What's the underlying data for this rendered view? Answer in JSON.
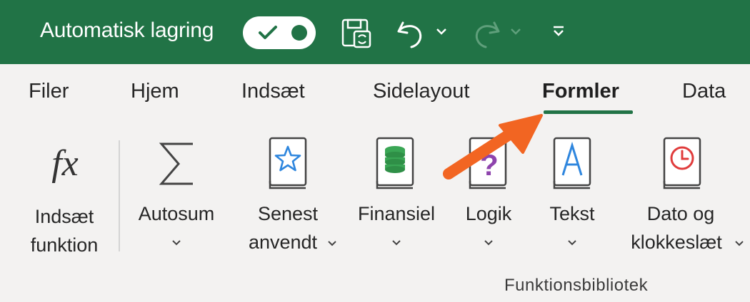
{
  "titlebar": {
    "autosave_label": "Automatisk lagring",
    "autosave_on": true
  },
  "tabs": [
    {
      "label": "Filer",
      "active": false
    },
    {
      "label": "Hjem",
      "active": false
    },
    {
      "label": "Indsæt",
      "active": false
    },
    {
      "label": "Sidelayout",
      "active": false
    },
    {
      "label": "Formler",
      "active": true
    },
    {
      "label": "Data",
      "active": false
    }
  ],
  "ribbon": {
    "insert_function": {
      "line1": "Indsæt",
      "line2": "funktion",
      "icon": "fx-icon"
    },
    "autosum": {
      "line1": "Autosum",
      "icon": "sigma-icon"
    },
    "recent": {
      "line1": "Senest",
      "line2": "anvendt",
      "icon": "star-book-icon"
    },
    "financial": {
      "line1": "Finansiel",
      "icon": "coins-book-icon"
    },
    "logical": {
      "line1": "Logik",
      "icon": "question-book-icon"
    },
    "text": {
      "line1": "Tekst",
      "icon": "letter-a-book-icon"
    },
    "datetime": {
      "line1": "Dato og",
      "line2": "klokkeslæt",
      "icon": "clock-book-icon"
    },
    "group_label": "Funktionsbibliotek"
  },
  "colors": {
    "titlebar": "#217346",
    "ribbon_bg": "#f3f2f1",
    "accent_arrow": "#f26522",
    "star_blue": "#2e86de",
    "coins_green": "#3aa655",
    "logic_purple": "#8e44ad",
    "clock_red": "#e03c3c"
  }
}
